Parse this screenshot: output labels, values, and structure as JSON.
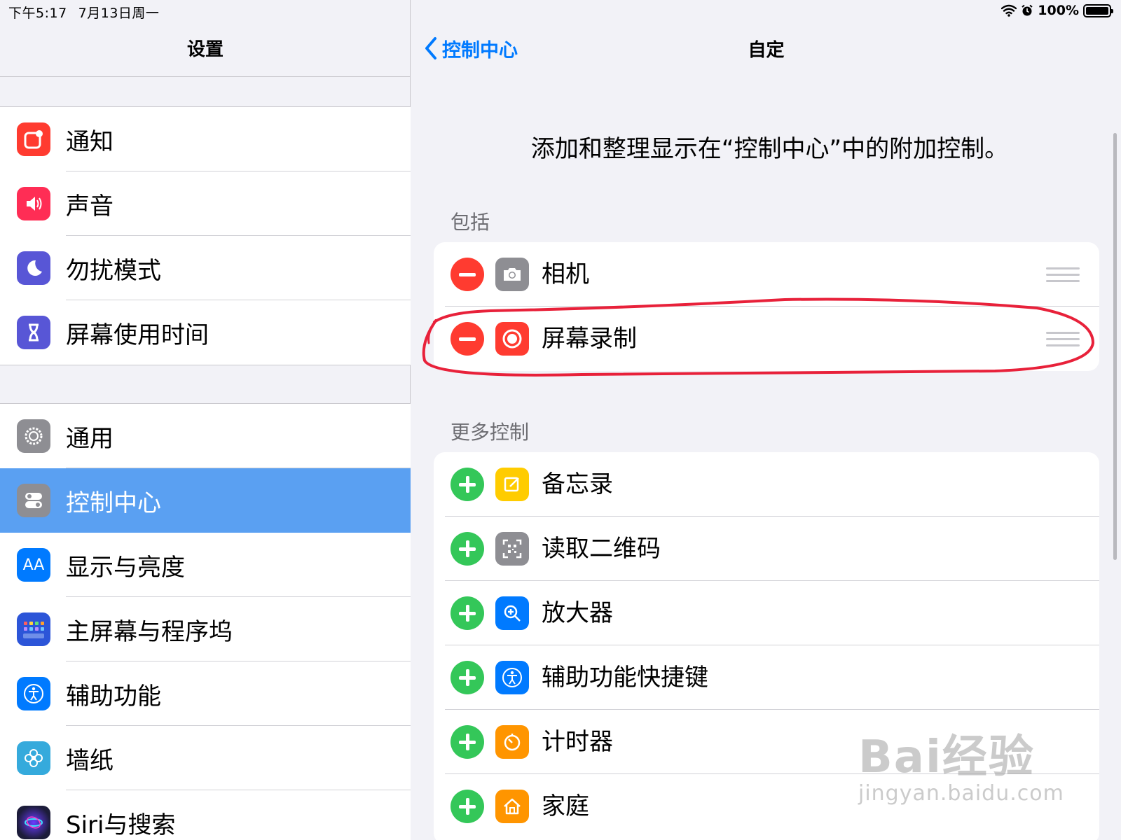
{
  "status": {
    "time": "下午5:17",
    "date": "7月13日周一",
    "battery": "100%"
  },
  "sidebar": {
    "title": "设置",
    "group1": [
      {
        "label": "通知",
        "icon": "notifications-icon",
        "color": "#ff3b30"
      },
      {
        "label": "声音",
        "icon": "sounds-icon",
        "color": "#ff2d55"
      },
      {
        "label": "勿扰模式",
        "icon": "moon-icon",
        "color": "#5856d6"
      },
      {
        "label": "屏幕使用时间",
        "icon": "hourglass-icon",
        "color": "#5856d6"
      }
    ],
    "group2": [
      {
        "label": "通用",
        "icon": "gear-icon",
        "color": "#8e8e93"
      },
      {
        "label": "控制中心",
        "icon": "toggles-icon",
        "color": "#8e8e93",
        "selected": true
      },
      {
        "label": "显示与亮度",
        "icon": "aa-icon",
        "color": "#007aff"
      },
      {
        "label": "主屏幕与程序坞",
        "icon": "home-grid-icon",
        "color": "#2c55d8"
      },
      {
        "label": "辅助功能",
        "icon": "accessibility-icon",
        "color": "#007aff"
      },
      {
        "label": "墙纸",
        "icon": "flower-icon",
        "color": "#35aadc"
      },
      {
        "label": "Siri与搜索",
        "icon": "siri-icon",
        "color": "#1c1c3a"
      }
    ]
  },
  "detail": {
    "back_label": "控制中心",
    "title": "自定",
    "description": "添加和整理显示在“控制中心”中的附加控制。",
    "included_header": "包括",
    "included": [
      {
        "label": "相机",
        "icon": "camera-icon",
        "color": "#8e8e93"
      },
      {
        "label": "屏幕录制",
        "icon": "screen-record-icon",
        "color": "#ff3b30"
      }
    ],
    "more_header": "更多控制",
    "more": [
      {
        "label": "备忘录",
        "icon": "notes-icon",
        "color": "#ffcc00"
      },
      {
        "label": "读取二维码",
        "icon": "qr-code-icon",
        "color": "#8e8e93"
      },
      {
        "label": "放大器",
        "icon": "magnifier-icon",
        "color": "#007aff"
      },
      {
        "label": "辅助功能快捷键",
        "icon": "accessibility-icon",
        "color": "#007aff"
      },
      {
        "label": "计时器",
        "icon": "timer-icon",
        "color": "#ff9500"
      },
      {
        "label": "家庭",
        "icon": "home-icon",
        "color": "#ff9500"
      }
    ]
  },
  "watermark": {
    "line1": "Bai经验",
    "line2": "jingyan.baidu.com"
  }
}
